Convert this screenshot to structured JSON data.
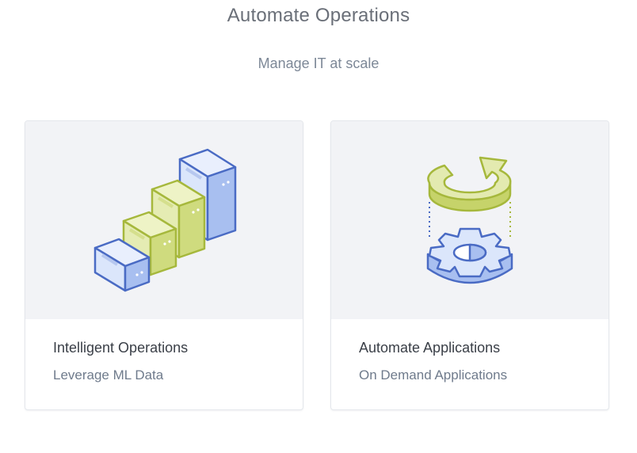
{
  "header": {
    "title": "Automate Operations",
    "subtitle": "Manage IT at scale"
  },
  "cards": [
    {
      "title": "Intelligent Operations",
      "subtitle": "Leverage ML Data",
      "icon": "server-stack-icon"
    },
    {
      "title": "Automate Applications",
      "subtitle": "On Demand Applications",
      "icon": "gear-refresh-icon"
    }
  ],
  "colors": {
    "blue_stroke": "#4a6bc4",
    "blue_fill": "#dbe6fb",
    "green_stroke": "#a6b83c",
    "green_fill": "#e5ecb3",
    "card_media_bg": "#f2f3f6"
  }
}
